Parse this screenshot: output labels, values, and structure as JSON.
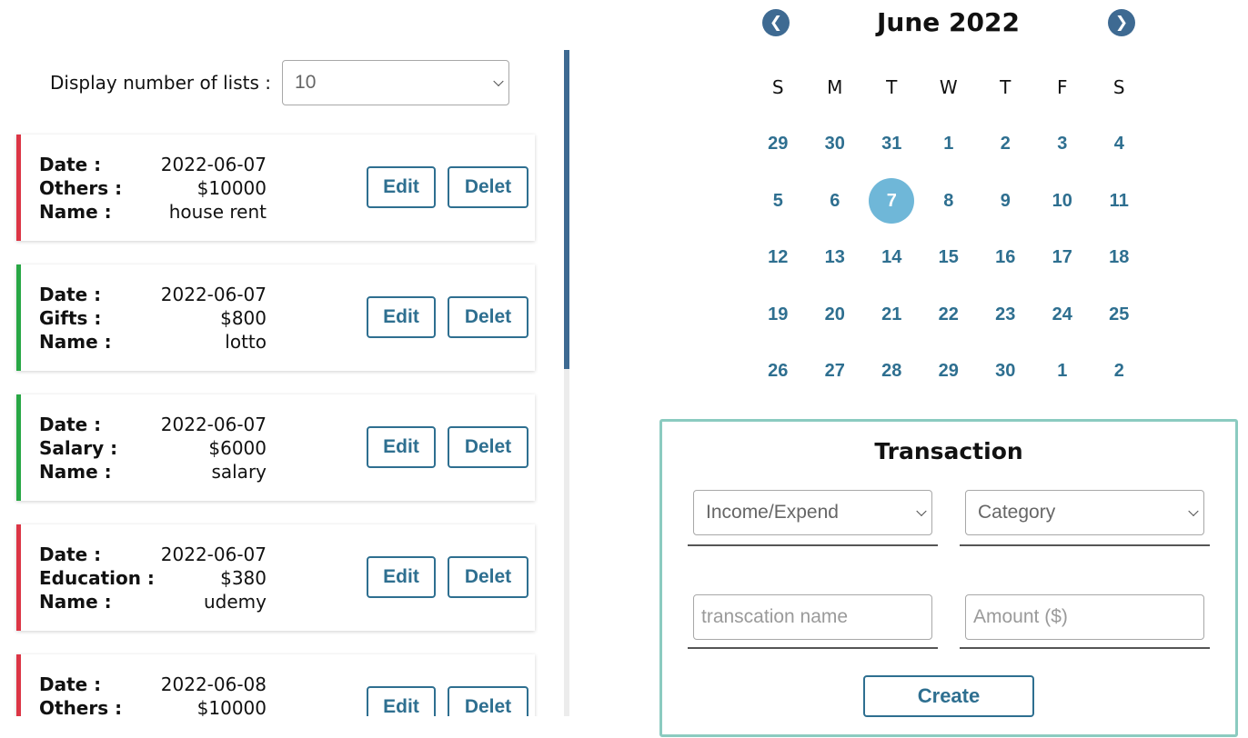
{
  "display": {
    "label": "Display number of lists :",
    "value": "10"
  },
  "buttons": {
    "edit": "Edit",
    "delete": "Delet"
  },
  "field_labels": {
    "date": "Date :",
    "name": "Name :"
  },
  "transactions": [
    {
      "date": "2022-06-07",
      "category": "Others :",
      "amount": "$10000",
      "name": "house rent",
      "type": "expense"
    },
    {
      "date": "2022-06-07",
      "category": "Gifts :",
      "amount": "$800",
      "name": "lotto",
      "type": "income"
    },
    {
      "date": "2022-06-07",
      "category": "Salary :",
      "amount": "$6000",
      "name": "salary",
      "type": "income"
    },
    {
      "date": "2022-06-07",
      "category": "Education :",
      "amount": "$380",
      "name": "udemy",
      "type": "expense"
    },
    {
      "date": "2022-06-08",
      "category": "Others :",
      "amount": "$10000",
      "name": "",
      "type": "expense"
    }
  ],
  "calendar": {
    "title": "June 2022",
    "prev_icon": "chevron-left-circle-icon",
    "next_icon": "chevron-right-circle-icon",
    "weekdays": [
      "S",
      "M",
      "T",
      "W",
      "T",
      "F",
      "S"
    ],
    "selected_day": "7",
    "weeks": [
      [
        "29",
        "30",
        "31",
        "1",
        "2",
        "3",
        "4"
      ],
      [
        "5",
        "6",
        "7",
        "8",
        "9",
        "10",
        "11"
      ],
      [
        "12",
        "13",
        "14",
        "15",
        "16",
        "17",
        "18"
      ],
      [
        "19",
        "20",
        "21",
        "22",
        "23",
        "24",
        "25"
      ],
      [
        "26",
        "27",
        "28",
        "29",
        "30",
        "1",
        "2"
      ]
    ]
  },
  "transaction_form": {
    "title": "Transaction",
    "type_select": "Income/Expend",
    "category_select": "Category",
    "name_placeholder": "transcation name",
    "amount_placeholder": "Amount ($)",
    "create_label": "Create"
  },
  "colors": {
    "expense_accent": "#dc3545",
    "income_accent": "#28a745",
    "primary": "#2e6f90",
    "selected_day": "#6fb7d8",
    "panel_border": "#8bcbc0",
    "scroll_thumb": "#3e6a92"
  }
}
